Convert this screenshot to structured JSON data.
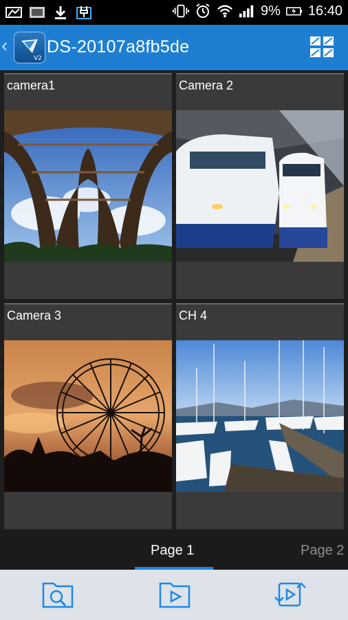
{
  "status_bar": {
    "battery": "9%",
    "time": "16:40"
  },
  "app_bar": {
    "title": "DS-20107a8fb5de"
  },
  "cameras": [
    {
      "label": "camera1",
      "scene": "eiffel-tower"
    },
    {
      "label": "Camera 2",
      "scene": "bullet-trains"
    },
    {
      "label": "Camera 3",
      "scene": "ferris-wheel-sunset"
    },
    {
      "label": "CH 4",
      "scene": "marina-boats"
    }
  ],
  "pager": {
    "tabs": [
      "Page 1",
      "Page 2"
    ],
    "active_index": 0
  },
  "colors": {
    "app_bar": "#1e7fd2",
    "accent": "#1e88e5"
  },
  "bottom_toolbar": {
    "icons": [
      "search-folder-icon",
      "playback-folder-icon",
      "playback-sync-icon"
    ]
  }
}
